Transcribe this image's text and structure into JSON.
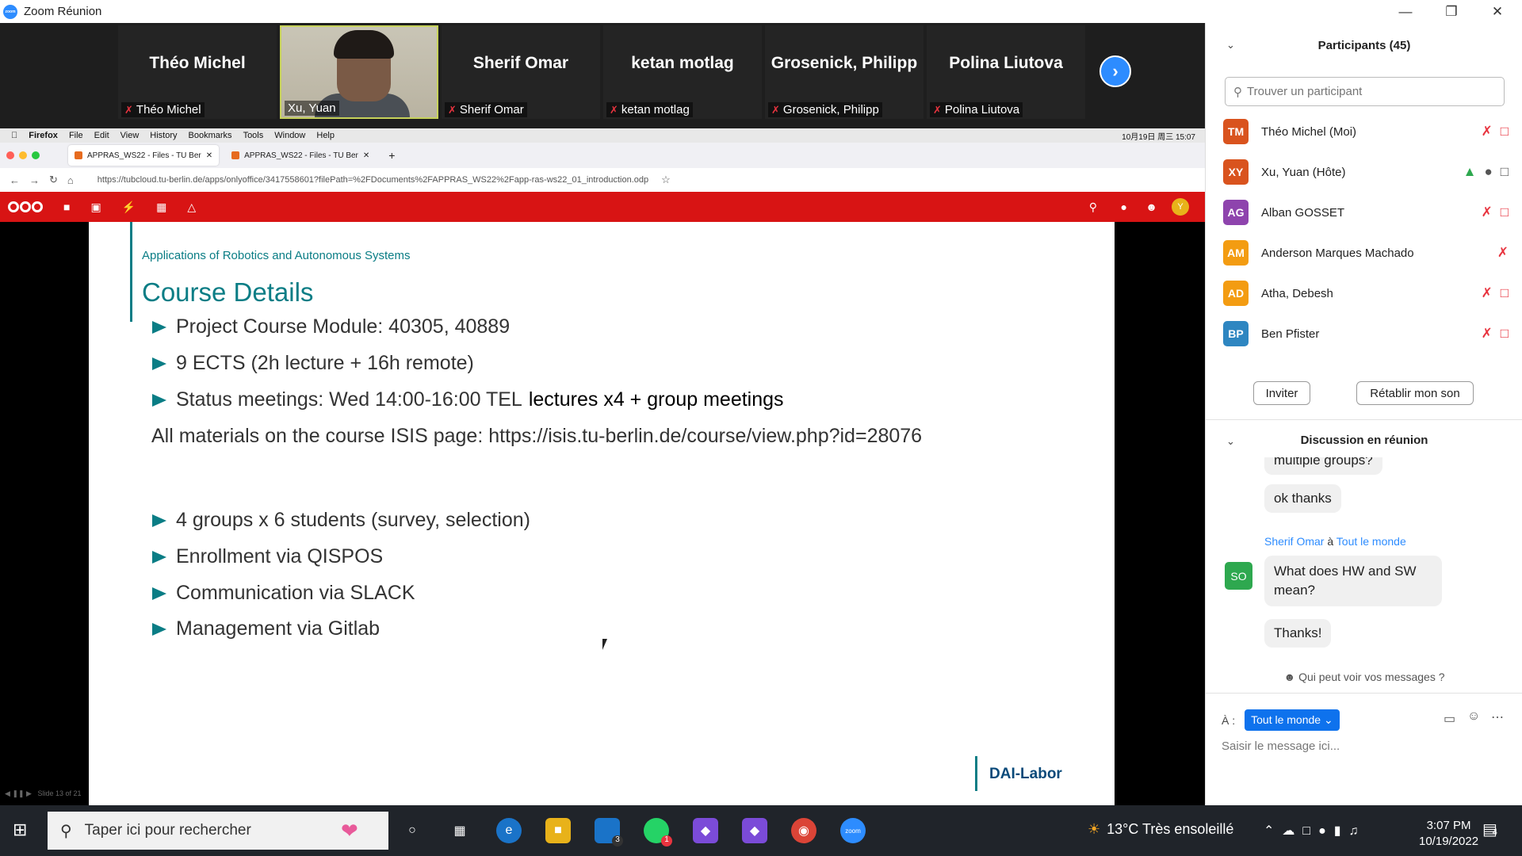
{
  "window": {
    "title": "Zoom Réunion"
  },
  "video_strip": {
    "tiles": [
      {
        "name": "Théo Michel",
        "label": "Théo Michel",
        "muted": true,
        "video": false
      },
      {
        "name": "Xu, Yuan",
        "label": "Xu, Yuan",
        "muted": false,
        "video": true
      },
      {
        "name": "Sherif Omar",
        "label": "Sherif Omar",
        "muted": true,
        "video": false
      },
      {
        "name": "ketan motlag",
        "label": "ketan motlag",
        "muted": true,
        "video": false
      },
      {
        "name": "Grosenick, Philipp",
        "label": "Grosenick, Philipp",
        "muted": true,
        "video": false
      },
      {
        "name": "Polina Liutova",
        "label": "Polina Liutova",
        "muted": true,
        "video": false
      }
    ]
  },
  "mac_menubar": {
    "items": [
      "Firefox",
      "File",
      "Edit",
      "View",
      "History",
      "Bookmarks",
      "Tools",
      "Window",
      "Help"
    ],
    "clock": "10月19日 周三 15:07"
  },
  "browser": {
    "tabs": [
      "APPRAS_WS22 - Files - TU Ber",
      "APPRAS_WS22 - Files - TU Ber"
    ],
    "url": "https://tubcloud.tu-berlin.de/apps/onlyoffice/3417558601?filePath=%2FDocuments%2FAPPRAS_WS22%2Fapp-ras-ws22_01_introduction.odp"
  },
  "slide": {
    "subtitle": "Applications of Robotics and Autonomous Systems",
    "heading": "Course Details",
    "bullets_top": [
      "Project Course Module: 40305, 40889",
      "9 ECTS (2h lecture + 16h remote)",
      "Status meetings: Wed 14:00-16:00 TEL"
    ],
    "status_extra": "lectures x4 + group meetings",
    "materials": "All materials on the course ISIS page: https://isis.tu-berlin.de/course/view.php?id=28076",
    "bullets_bottom": [
      "4 groups x 6 students (survey, selection)",
      "Enrollment via QISPOS",
      "Communication via SLACK",
      "Management via Gitlab"
    ],
    "footer_logo": "DAI-Labor",
    "controls": "Slide 13 of 21"
  },
  "participants": {
    "header": "Participants (45)",
    "search_placeholder": "Trouver un participant",
    "list": [
      {
        "initials": "TM",
        "name": "Théo Michel (Moi)",
        "color": "#d9531e"
      },
      {
        "initials": "XY",
        "name": "Xu, Yuan (Hôte)",
        "color": "#d9531e"
      },
      {
        "initials": "AG",
        "name": "Alban GOSSET",
        "color": "#8e44ad"
      },
      {
        "initials": "AM",
        "name": "Anderson Marques Machado",
        "color": "#f39c12"
      },
      {
        "initials": "AD",
        "name": "Atha, Debesh",
        "color": "#f39c12"
      },
      {
        "initials": "BP",
        "name": "Ben Pfister",
        "color": "#2e86c1"
      }
    ],
    "invite_label": "Inviter",
    "unmute_label": "Rétablir mon son"
  },
  "chat": {
    "header": "Discussion en réunion",
    "msg_partial": "multiple groups?",
    "msg_ok": "ok thanks",
    "sender": "Sherif Omar",
    "sender_sep": "à",
    "sender_to": "Tout le monde",
    "sender_initials": "SO",
    "msg_hw": "What does HW and SW mean?",
    "msg_thanks": "Thanks!",
    "who_sees": "Qui peut voir vos messages ?",
    "to_label": "À :",
    "to_value": "Tout le monde",
    "input_placeholder": "Saisir le message ici..."
  },
  "taskbar": {
    "search_placeholder": "Taper ici pour rechercher",
    "weather": "13°C  Très ensoleillé",
    "time": "3:07 PM",
    "date": "10/19/2022",
    "notification_count": "4",
    "mail_badge": "3",
    "whatsapp_badge": "1"
  },
  "colors": {
    "zoom_blue": "#2d8cff",
    "nextcloud_red": "#d81414",
    "slide_teal": "#0a7d85",
    "mute_red": "#e8343f"
  }
}
